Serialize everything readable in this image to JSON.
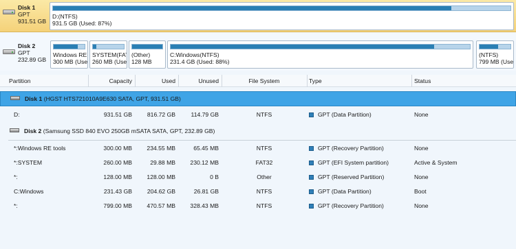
{
  "colors": {
    "selected_row": "#3fa4e6",
    "bar_fill": "#2a7fb4",
    "selected_disk": "#f5d27a"
  },
  "disk_map": {
    "disks": [
      {
        "name": "Disk 1",
        "type": "GPT",
        "size": "931.51 GB",
        "partitions": [
          {
            "label": "D:(NTFS)",
            "detail": "931.5 GB (Used: 87%)",
            "used_pct": 0.87
          }
        ]
      },
      {
        "name": "Disk 2",
        "type": "GPT",
        "size": "232.89 GB",
        "partitions": [
          {
            "label": "Windows RE",
            "detail": "300 MB (Use",
            "used_pct": 0.78
          },
          {
            "label": "SYSTEM(FAT",
            "detail": "260 MB (Use",
            "used_pct": 0.12
          },
          {
            "label": "(Other)",
            "detail": "128 MB",
            "used_pct": 1.0
          },
          {
            "label": "C:Windows(NTFS)",
            "detail": "231.4 GB (Used: 88%)",
            "used_pct": 0.88
          },
          {
            "label": "(NTFS)",
            "detail": "799 MB (Use",
            "used_pct": 0.59
          }
        ]
      }
    ]
  },
  "table": {
    "columns": [
      "Partition",
      "Capacity",
      "Used",
      "Unused",
      "File System",
      "Type",
      "Status"
    ],
    "groups": [
      {
        "disk": "Disk 1",
        "detail": "(HGST HTS721010A9E630 SATA, GPT, 931.51 GB)",
        "rows": [
          {
            "partition": "D:",
            "capacity": "931.51 GB",
            "used": "816.72 GB",
            "unused": "114.79 GB",
            "fs": "NTFS",
            "type": "GPT (Data Partition)",
            "status": "None"
          }
        ]
      },
      {
        "disk": "Disk 2",
        "detail": "(Samsung SSD 840 EVO 250GB mSATA SATA, GPT, 232.89 GB)",
        "rows": [
          {
            "partition": "*:Windows RE tools",
            "capacity": "300.00 MB",
            "used": "234.55 MB",
            "unused": "65.45 MB",
            "fs": "NTFS",
            "type": "GPT (Recovery Partition)",
            "status": "None"
          },
          {
            "partition": "*:SYSTEM",
            "capacity": "260.00 MB",
            "used": "29.88 MB",
            "unused": "230.12 MB",
            "fs": "FAT32",
            "type": "GPT (EFI System partition)",
            "status": "Active & System"
          },
          {
            "partition": "*:",
            "capacity": "128.00 MB",
            "used": "128.00 MB",
            "unused": "0 B",
            "fs": "Other",
            "type": "GPT (Reserved Partition)",
            "status": "None"
          },
          {
            "partition": "C:Windows",
            "capacity": "231.43 GB",
            "used": "204.62 GB",
            "unused": "26.81 GB",
            "fs": "NTFS",
            "type": "GPT (Data Partition)",
            "status": "Boot"
          },
          {
            "partition": "*:",
            "capacity": "799.00 MB",
            "used": "470.57 MB",
            "unused": "328.43 MB",
            "fs": "NTFS",
            "type": "GPT (Recovery Partition)",
            "status": "None"
          }
        ]
      }
    ]
  }
}
